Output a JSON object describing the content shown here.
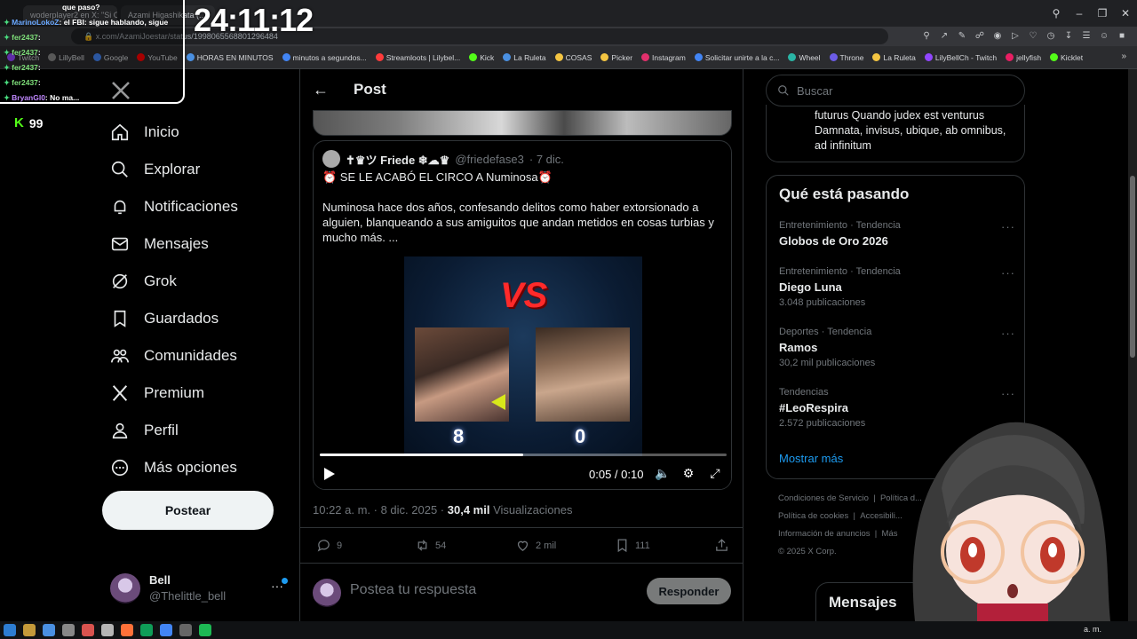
{
  "stream": {
    "timer": "24:11:12",
    "kick_count": "99",
    "chat": [
      {
        "user": "",
        "msg": "que paso?"
      },
      {
        "user": "MarinoLokoZ",
        "msg": "el FBI: sigue hablando, sigue"
      },
      {
        "user": "fer2437",
        "msg": ""
      },
      {
        "user": "fer2437",
        "msg": ""
      },
      {
        "user": "fer2437",
        "msg": ""
      },
      {
        "user": "fer2437",
        "msg": ""
      },
      {
        "user": "BryanGl0",
        "msg": "No ma..."
      }
    ]
  },
  "browser": {
    "tabs": [
      "woderplayer2 en X: \"Si C...",
      "Azami Higashikata (..."
    ],
    "url": "x.com/AzamiJoestar/status/1998065568801296484",
    "bookmarks": [
      "Twitch",
      "LillyBell",
      "Google",
      "YouTube",
      "HORAS EN MINUTOS",
      "minutos a segundos...",
      "Streamloots | Lilybel...",
      "Kick",
      "La Ruleta",
      "COSAS",
      "Picker",
      "Instagram",
      "Solicitar unirte a la c...",
      "Wheel",
      "Throne",
      "La Ruleta",
      "LilyBellCh - Twitch",
      "jellyfish",
      "Kicklet"
    ],
    "bookmark_colors": [
      "#9146ff",
      "#888888",
      "#4285f4",
      "#ff0000",
      "#4a90e2",
      "#4285f4",
      "#ff3b3b",
      "#53fc18",
      "#4a90e2",
      "#f4c542",
      "#f4c542",
      "#e1306c",
      "#4285f4",
      "#2ab5a5",
      "#6c5ce7",
      "#f4c542",
      "#9146ff",
      "#e91e63",
      "#53fc18"
    ]
  },
  "sidebar": {
    "items": [
      {
        "label": "Inicio",
        "icon": "home-icon"
      },
      {
        "label": "Explorar",
        "icon": "search-icon"
      },
      {
        "label": "Notificaciones",
        "icon": "bell-icon"
      },
      {
        "label": "Mensajes",
        "icon": "mail-icon"
      },
      {
        "label": "Grok",
        "icon": "grok-icon"
      },
      {
        "label": "Guardados",
        "icon": "bookmark-icon"
      },
      {
        "label": "Comunidades",
        "icon": "communities-icon"
      },
      {
        "label": "Premium",
        "icon": "x-icon"
      },
      {
        "label": "Perfil",
        "icon": "person-icon"
      },
      {
        "label": "Más opciones",
        "icon": "more-icon"
      }
    ],
    "post_button": "Postear",
    "account": {
      "name": "Bell",
      "handle": "@Thelittle_bell"
    }
  },
  "main": {
    "header_title": "Post",
    "quote": {
      "name": "✝♛ツ Friede ❄☁♛",
      "handle": "@friedefase3",
      "date": "· 7 dic.",
      "title": "⏰ SE LE ACABÓ EL CIRCO A Numinosa⏰",
      "body": "Numinosa hace dos años, confesando delitos como haber extorsionado a alguien, blanqueando a sus amiguitos que andan metidos en cosas turbias y mucho más. ...",
      "video": {
        "vs_text": "VS",
        "score_left": "8",
        "score_right": "0",
        "time": "0:05 / 0:10",
        "progress": 0.5
      }
    },
    "meta": {
      "time": "10:22 a. m. · 8 dic. 2025 ·",
      "views": "30,4 mil",
      "views_label": "Visualizaciones"
    },
    "actions": {
      "replies": "9",
      "reposts": "54",
      "likes": "2 mil",
      "bookmarks": "111"
    },
    "reply_placeholder": "Postea tu respuesta",
    "reply_button": "Responder"
  },
  "right": {
    "search_placeholder": "Buscar",
    "latin_text": "futurus Quando judex est venturus Damnata, invisus, ubique, ab omnibus, ad infinitum",
    "trends_title": "Qué está pasando",
    "trends": [
      {
        "category": "Entretenimiento · Tendencia",
        "name": "Globos de Oro 2026",
        "count": ""
      },
      {
        "category": "Entretenimiento · Tendencia",
        "name": "Diego Luna",
        "count": "3.048 publicaciones"
      },
      {
        "category": "Deportes · Tendencia",
        "name": "Ramos",
        "count": "30,2 mil publicaciones"
      },
      {
        "category": "Tendencias",
        "name": "#LeoRespira",
        "count": "2.572 publicaciones"
      }
    ],
    "show_more": "Mostrar más",
    "footer": {
      "line1": [
        "Condiciones de Servicio",
        "|",
        "Política d..."
      ],
      "line2": [
        "Política de cookies",
        "|",
        "Accesibili..."
      ],
      "line3": [
        "Información de anuncios",
        "|",
        "Más"
      ],
      "copyright": "© 2025 X Corp."
    },
    "messages_panel": "Mensajes"
  },
  "taskbar": {
    "clock": "a. m."
  }
}
